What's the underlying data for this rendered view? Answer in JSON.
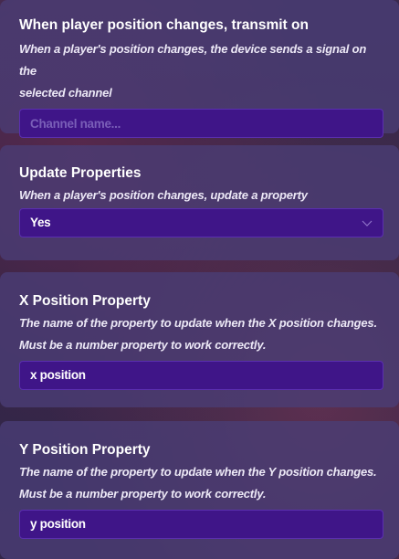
{
  "sections": [
    {
      "title": "When player position changes, transmit on",
      "desc_lines": [
        "When a player's position changes, the device sends a signal on the",
        "selected channel"
      ],
      "input": {
        "value": "",
        "placeholder": "Channel name..."
      }
    },
    {
      "title": "Update Properties",
      "desc_lines": [
        "When a player's position changes, update a property"
      ],
      "select": {
        "value": "Yes",
        "icon": "chevron-down-icon"
      }
    },
    {
      "title": "X Position Property",
      "desc_lines": [
        "The name of the property to update when the X position changes.",
        "Must be a number property to work correctly."
      ],
      "input": {
        "value": "x position",
        "placeholder": ""
      }
    },
    {
      "title": "Y Position Property",
      "desc_lines": [
        "The name of the property to update when the Y position changes.",
        "Must be a number property to work correctly."
      ],
      "input": {
        "value": "y position",
        "placeholder": ""
      }
    }
  ]
}
